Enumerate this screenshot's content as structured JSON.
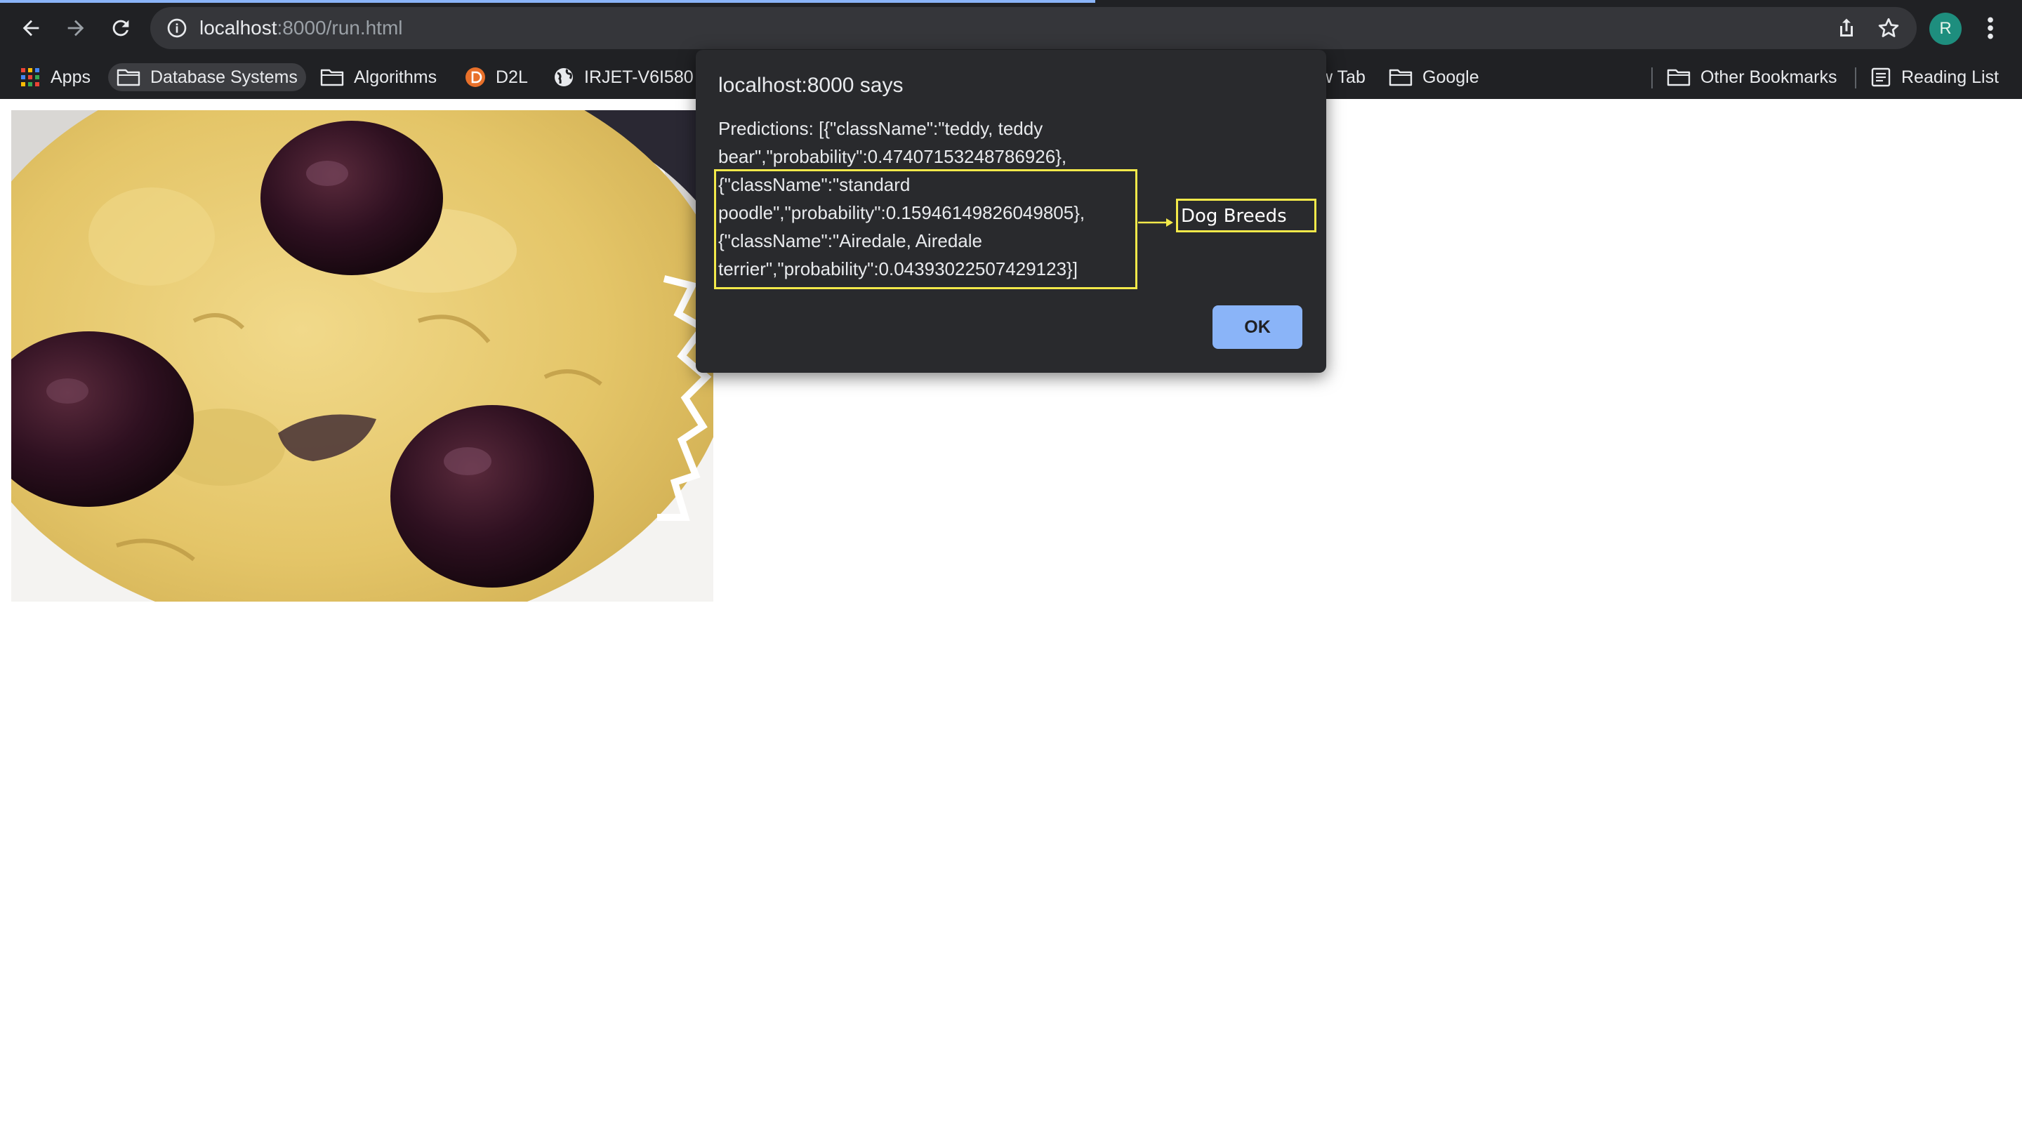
{
  "browser": {
    "url_host": "localhost",
    "url_path": ":8000/run.html",
    "avatar_letter": "R",
    "bookmarks": [
      {
        "label": "Apps",
        "icon": "apps-grid-icon"
      },
      {
        "label": "Database Systems",
        "icon": "folder-icon"
      },
      {
        "label": "Algorithms",
        "icon": "folder-icon"
      },
      {
        "label": "D2L",
        "icon": "d2l-favicon-icon"
      },
      {
        "label": "IRJET-V6I580",
        "icon": "globe-icon"
      },
      {
        "label": "w Tab",
        "icon": ""
      },
      {
        "label": "Google",
        "icon": "folder-icon"
      },
      {
        "label": "Other Bookmarks",
        "icon": "folder-icon"
      },
      {
        "label": "Reading List",
        "icon": "reading-list-icon"
      }
    ]
  },
  "dialog": {
    "title": "localhost:8000 says",
    "message_lines": [
      "Predictions: [{\"className\":\"teddy, teddy",
      "bear\",\"probability\":0.47407153248786926},",
      "{\"className\":\"standard",
      "poodle\",\"probability\":0.15946149826049805},",
      "{\"className\":\"Airedale, Airedale",
      "terrier\",\"probability\":0.04393022507429123}]"
    ],
    "annotation": "Dog Breeds",
    "ok_label": "OK"
  },
  "colors": {
    "chrome": "#202124",
    "dialog": "#292a2d",
    "highlight": "#f3e94a",
    "ok_button": "#8ab4f8"
  }
}
